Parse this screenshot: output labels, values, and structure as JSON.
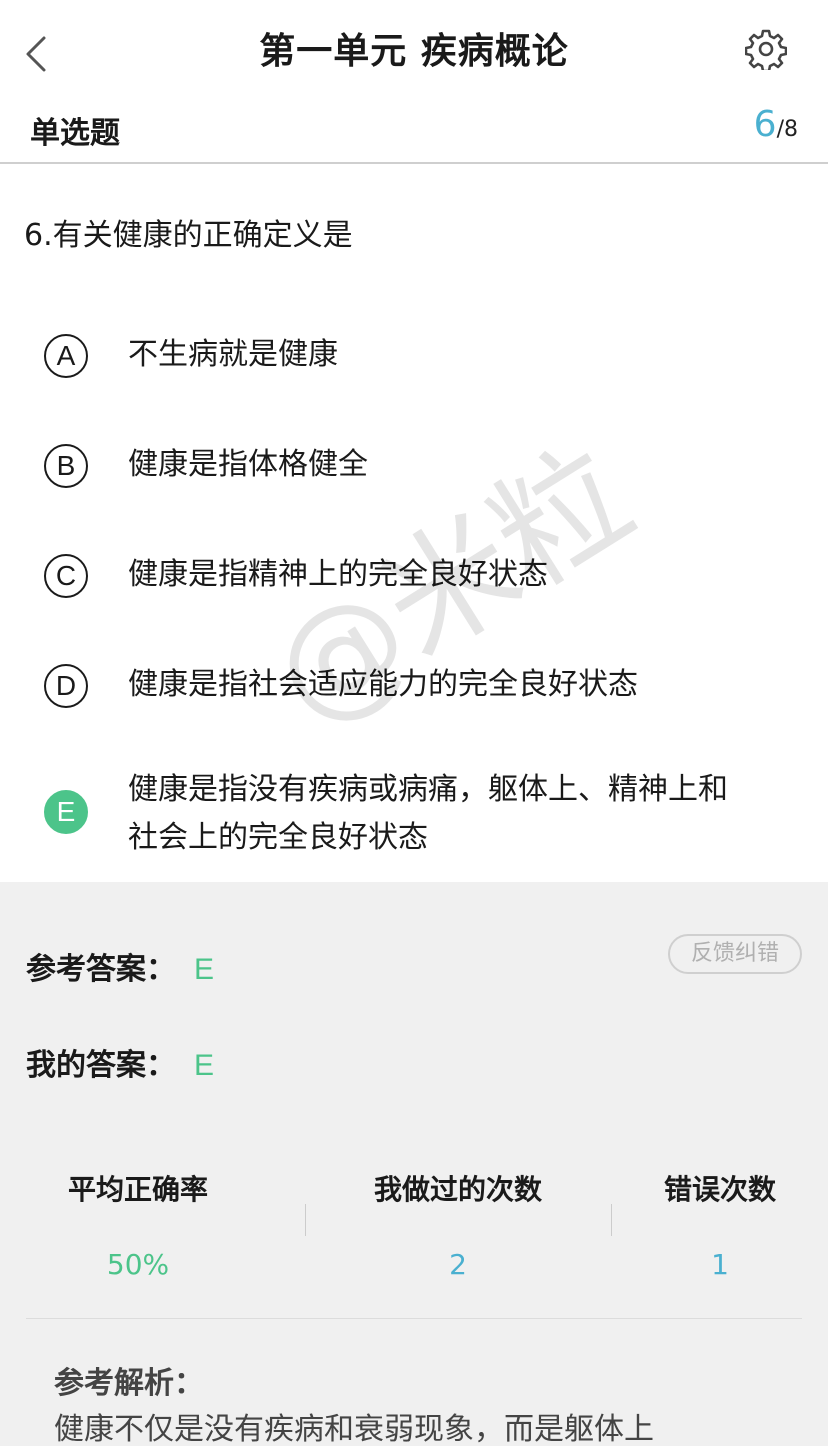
{
  "nav": {
    "back_icon": "chevron-left-icon",
    "title": "第一单元 疾病概论",
    "settings_icon": "gear-icon"
  },
  "subheader": {
    "question_type": "单选题",
    "current": "6",
    "total": "/8"
  },
  "question": {
    "text": "6.有关健康的正确定义是",
    "options": [
      {
        "letter": "A",
        "text": "不生病就是健康",
        "selected": false
      },
      {
        "letter": "B",
        "text": "健康是指体格健全",
        "selected": false
      },
      {
        "letter": "C",
        "text": "健康是指精神上的完全良好状态",
        "selected": false
      },
      {
        "letter": "D",
        "text": "健康是指社会适应能力的完全良好状态",
        "selected": false
      },
      {
        "letter": "E",
        "text": "健康是指没有疾病或病痛，躯体上、精神上和社会上的完全良好状态",
        "selected": true
      }
    ]
  },
  "answers": {
    "reference_label": "参考答案：",
    "reference_value": "E",
    "mine_label": "我的答案：",
    "mine_value": "E",
    "feedback_button": "反馈纠错"
  },
  "stats": [
    {
      "label": "平均正确率",
      "value": "50%",
      "color": "#4cc48a"
    },
    {
      "label": "我做过的次数",
      "value": "2",
      "color": "#4ab0d0"
    },
    {
      "label": "错误次数",
      "value": "1",
      "color": "#4ab0d0"
    }
  ],
  "analysis": {
    "title": "参考解析：",
    "text": "健康不仅是没有疾病和衰弱现象，而是躯体上"
  },
  "watermark": "@米粒",
  "colors": {
    "accent_green": "#4cc48a",
    "accent_blue": "#4ab0d0"
  }
}
